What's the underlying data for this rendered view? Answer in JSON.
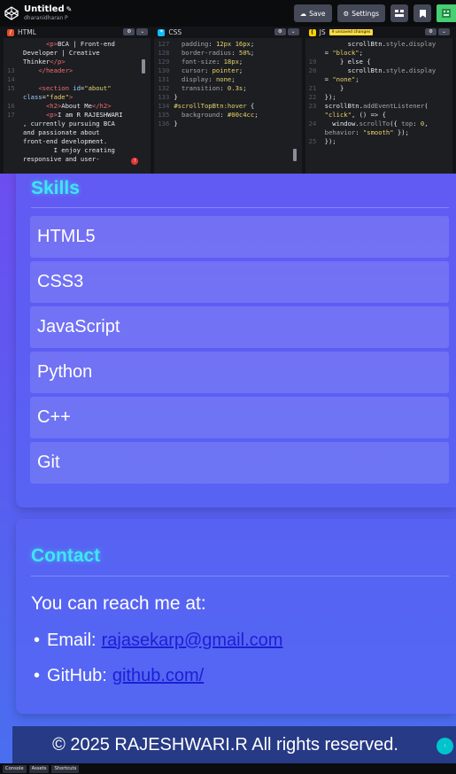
{
  "app": {
    "title": "Untitled",
    "author": "dharanidharan P",
    "save_label": "Save",
    "settings_label": "Settings"
  },
  "editors": {
    "html": {
      "name": "HTML",
      "lines": [
        {
          "n": "",
          "html": "      <span class=\"tag\">&lt;p&gt;</span>BCA | Front-end"
        },
        {
          "n": "",
          "html": "Developer | Creative"
        },
        {
          "n": "",
          "html": "Thinker<span class=\"tag\">&lt;/p&gt;</span>"
        },
        {
          "n": "13",
          "html": "    <span class=\"tag\">&lt;/header&gt;</span>"
        },
        {
          "n": "14",
          "html": ""
        },
        {
          "n": "15",
          "html": "    <span class=\"tag\">&lt;section</span> <span class=\"attr\">id</span>=<span class=\"str\">\"about\"</span>"
        },
        {
          "n": "",
          "html": "<span class=\"attr\">class</span>=<span class=\"str\">\"fade\"</span><span class=\"tag\">&gt;</span>"
        },
        {
          "n": "16",
          "html": "      <span class=\"tag\">&lt;h2&gt;</span>About Me<span class=\"tag\">&lt;/h2&gt;</span>"
        },
        {
          "n": "17",
          "html": "      <span class=\"tag\">&lt;p&gt;</span>I am R RAJESHWARI"
        },
        {
          "n": "",
          "html": ", currently pursuing BCA"
        },
        {
          "n": "",
          "html": "and passionate about"
        },
        {
          "n": "",
          "html": "front-end development."
        },
        {
          "n": "",
          "html": "        I enjoy creating"
        },
        {
          "n": "",
          "html": "responsive and user-"
        }
      ]
    },
    "css": {
      "name": "CSS",
      "lines": [
        {
          "n": "127",
          "html": "  <span class=\"prop\">padding</span>: <span class=\"str\">12px 16px</span>;"
        },
        {
          "n": "128",
          "html": "  <span class=\"prop\">border-radius</span>: <span class=\"str\">50%</span>;"
        },
        {
          "n": "129",
          "html": "  <span class=\"prop\">font-size</span>: <span class=\"str\">18px</span>;"
        },
        {
          "n": "130",
          "html": "  <span class=\"prop\">cursor</span>: <span class=\"str\">pointer</span>;"
        },
        {
          "n": "131",
          "html": "  <span class=\"prop\">display</span>: <span class=\"str\">none</span>;"
        },
        {
          "n": "132",
          "html": "  <span class=\"prop\">transition</span>: <span class=\"str\">0.3s</span>;"
        },
        {
          "n": "133",
          "html": "}"
        },
        {
          "n": "134",
          "html": "<span class=\"sel\">#scrollTopBtn:hover</span> {"
        },
        {
          "n": "135",
          "html": "  <span class=\"prop\">background</span>: <span class=\"str\">#00c4cc</span>;"
        },
        {
          "n": "136",
          "html": "}"
        }
      ]
    },
    "js": {
      "name": "JS",
      "unsaved_badge": "9 unsaved changes",
      "lines": [
        {
          "n": "",
          "html": "      scrollBtn.<span class=\"prop\">style</span>.<span class=\"prop\">display</span>"
        },
        {
          "n": "",
          "html": "= <span class=\"str\">\"block\"</span>;"
        },
        {
          "n": "19",
          "html": "    } <span class=\"kw\">else</span> {"
        },
        {
          "n": "20",
          "html": "      scrollBtn.<span class=\"prop\">style</span>.<span class=\"prop\">display</span>"
        },
        {
          "n": "",
          "html": "= <span class=\"str\">\"none\"</span>;"
        },
        {
          "n": "21",
          "html": "    }"
        },
        {
          "n": "22",
          "html": "});"
        },
        {
          "n": "23",
          "html": "scrollBtn.<span class=\"prop\">addEventListener</span>("
        },
        {
          "n": "",
          "html": "<span class=\"str\">\"click\"</span>, () =&gt; {"
        },
        {
          "n": "24",
          "html": "  window.<span class=\"prop\">scrollTo</span>({ <span class=\"prop\">top</span>: <span class=\"str\">0</span>,"
        },
        {
          "n": "",
          "html": "<span class=\"prop\">behavior</span>: <span class=\"str\">\"smooth\"</span> });"
        },
        {
          "n": "25",
          "html": "});"
        }
      ]
    }
  },
  "preview": {
    "skills": {
      "heading": "Skills",
      "items": [
        "HTML5",
        "CSS3",
        "JavaScript",
        "Python",
        "C++",
        "Git"
      ]
    },
    "contact": {
      "heading": "Contact",
      "intro": "You can reach me at:",
      "email_label": "Email:",
      "email_value": "rajasekarp@gmail.com",
      "github_label": "GitHub:",
      "github_value": "github.com/"
    },
    "footer": "© 2025 RAJESHWARI.R All rights reserved."
  },
  "bottombar": {
    "console": "Console",
    "assets": "Assets",
    "shortcuts": "Shortcuts"
  },
  "colors": {
    "accent_cyan": "#00c4cc",
    "heading_cyan": "#3fe6f5",
    "link": "#1c1fd6",
    "footer_bg": "#273a86"
  }
}
